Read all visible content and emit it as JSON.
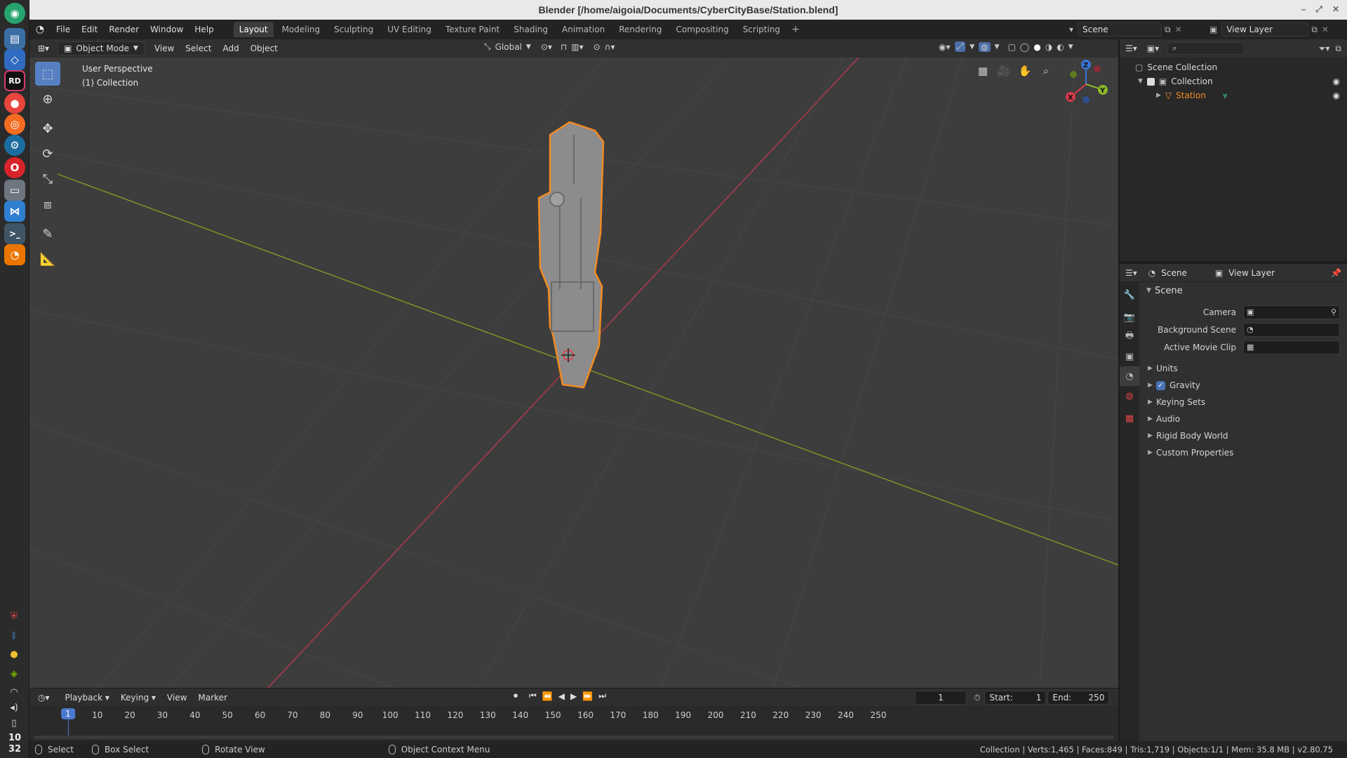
{
  "window": {
    "title": "Blender [/home/aigoia/Documents/CyberCityBase/Station.blend]"
  },
  "dock": {
    "icons": [
      "blender-like-icon",
      "files-icon",
      "vscode-icon",
      "rider-icon",
      "chrome-icon",
      "origin-icon",
      "steam-icon",
      "opera-icon",
      "folder-icon",
      "vs-icon",
      "terminal-icon",
      "blender-icon"
    ],
    "clock": {
      "hour": "10",
      "minute": "32"
    }
  },
  "topbar": {
    "menus": [
      "File",
      "Edit",
      "Render",
      "Window",
      "Help"
    ],
    "workspaces": [
      "Layout",
      "Modeling",
      "Sculpting",
      "UV Editing",
      "Texture Paint",
      "Shading",
      "Animation",
      "Rendering",
      "Compositing",
      "Scripting"
    ],
    "active_workspace": "Layout",
    "scene_name": "Scene",
    "view_layer": "View Layer"
  },
  "viewport_header": {
    "mode": "Object Mode",
    "menus": [
      "View",
      "Select",
      "Add",
      "Object"
    ],
    "transform_orientation": "Global"
  },
  "viewport": {
    "overlay_line1": "User Perspective",
    "overlay_line2": "(1) Collection",
    "gizmo_labels": {
      "x": "X",
      "y": "Y",
      "z": "Z"
    },
    "colors": {
      "x_axis": "#c0392b",
      "y_axis": "#7fa12c",
      "selection": "#f28b22",
      "grid_bg": "#3d3d3d"
    }
  },
  "outliner": {
    "root": "Scene Collection",
    "collection": "Collection",
    "object": "Station"
  },
  "properties": {
    "breadcrumb_scene": "Scene",
    "breadcrumb_layer": "View Layer",
    "panel_title": "Scene",
    "fields": [
      {
        "label": "Camera",
        "value": ""
      },
      {
        "label": "Background Scene",
        "value": ""
      },
      {
        "label": "Active Movie Clip",
        "value": ""
      }
    ],
    "subpanels": [
      "Units",
      "Gravity",
      "Keying Sets",
      "Audio",
      "Rigid Body World",
      "Custom Properties"
    ],
    "gravity_checked": true
  },
  "timeline": {
    "menus": [
      "Playback",
      "Keying",
      "View",
      "Marker"
    ],
    "current_frame": "1",
    "start_label": "Start:",
    "start_value": "1",
    "end_label": "End:",
    "end_value": "250",
    "ruler": [
      "1",
      "10",
      "20",
      "30",
      "40",
      "50",
      "60",
      "70",
      "80",
      "90",
      "100",
      "110",
      "120",
      "130",
      "140",
      "150",
      "160",
      "170",
      "180",
      "190",
      "200",
      "210",
      "220",
      "230",
      "240",
      "250"
    ]
  },
  "statusbar": {
    "select": "Select",
    "box_select": "Box Select",
    "rotate_view": "Rotate View",
    "context_menu": "Object Context Menu",
    "stats": "Collection | Verts:1,465 | Faces:849 | Tris:1,719 | Objects:1/1 | Mem: 35.8 MB | v2.80.75"
  }
}
